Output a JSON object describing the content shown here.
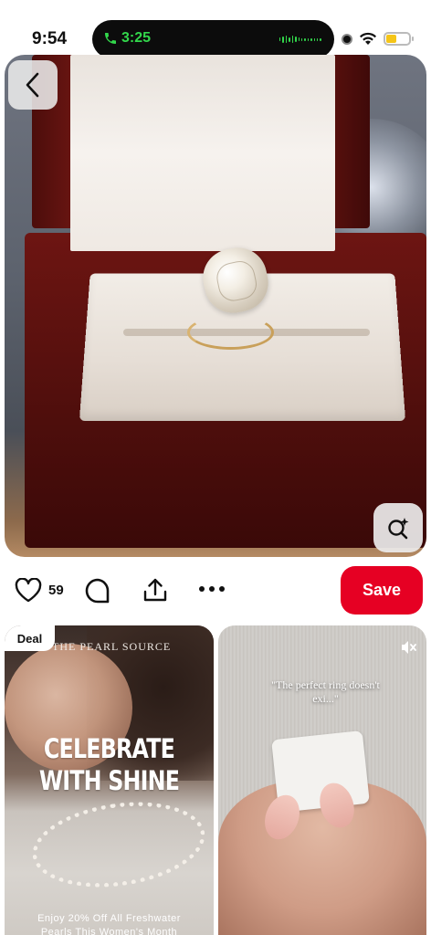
{
  "status_bar": {
    "time": "9:54",
    "call_time": "3:25",
    "accent_call": "#32d74b",
    "battery_level": 0.45,
    "battery_color": "#f5c518"
  },
  "pin": {
    "back_icon": "chevron-left-icon",
    "visual_search_icon": "lens-search-icon",
    "image_subject": "diamond ring in red wooden box"
  },
  "actions": {
    "like_icon": "heart-outline-icon",
    "like_count": "59",
    "comment_icon": "comment-bubble-icon",
    "share_icon": "share-upload-icon",
    "more_icon": "more-horizontal-icon",
    "save_label": "Save",
    "save_color": "#e60023"
  },
  "feed": {
    "cards": [
      {
        "badge": "Deal",
        "brand": "THE PEARL SOURCE",
        "headline_line1": "CELEBRATE",
        "headline_line2": "WITH SHINE",
        "sub_line1": "Enjoy 20% Off All Freshwater",
        "sub_line2": "Pearls This Women's Month"
      },
      {
        "quote_line1": "\"The perfect ring doesn't",
        "quote_line2": "exi...\"",
        "mute_icon": "speaker-muted-icon"
      }
    ]
  }
}
